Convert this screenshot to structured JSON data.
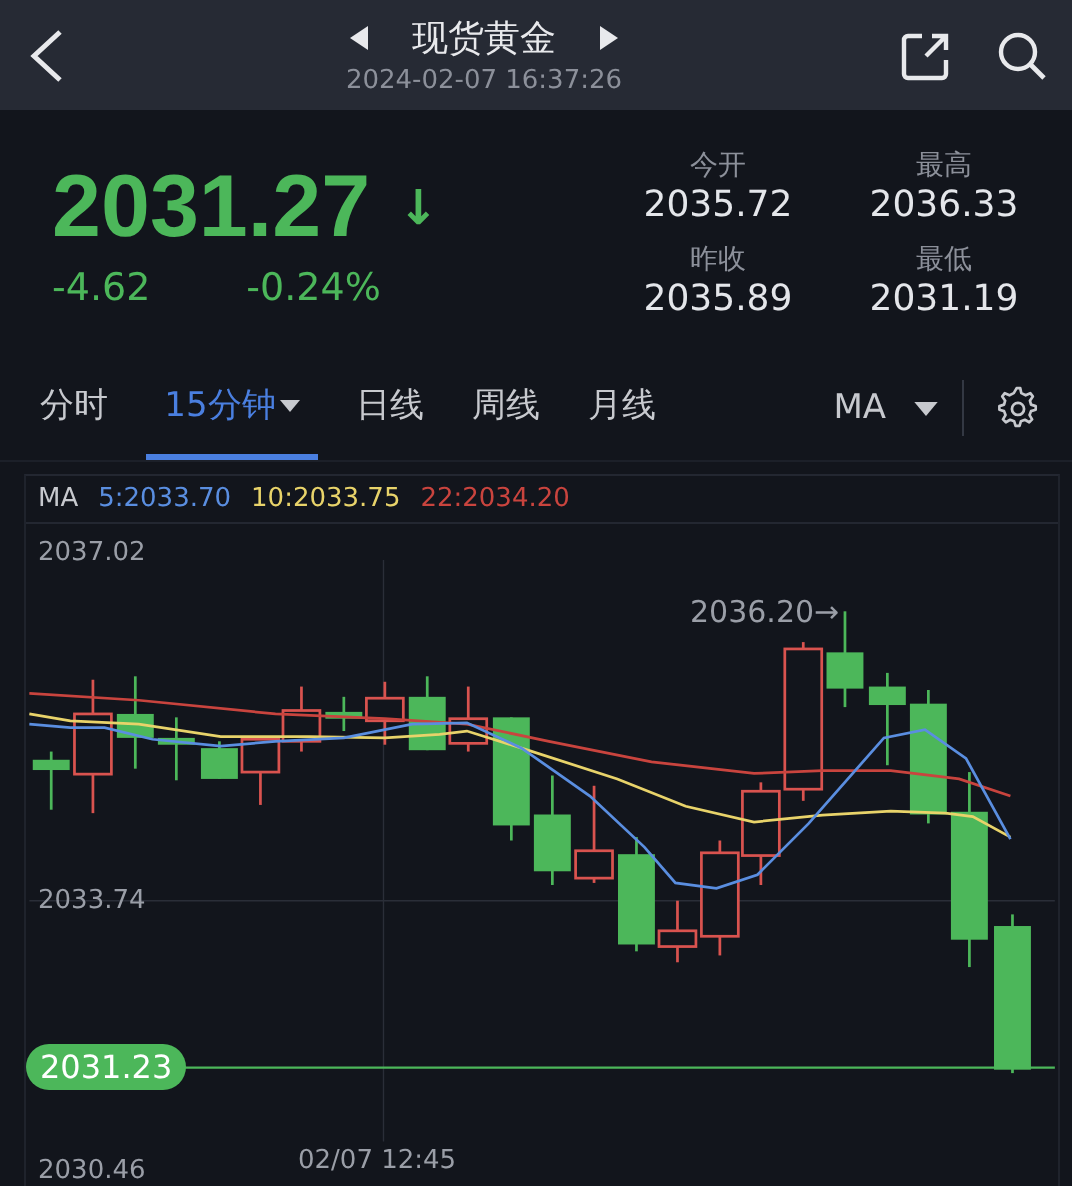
{
  "header": {
    "title": "现货黄金",
    "datetime": "2024-02-07 16:37:26"
  },
  "quote": {
    "price": "2031.27",
    "arrow": "↓",
    "change": "-4.62",
    "change_percent": "-0.24%"
  },
  "stats": [
    {
      "label": "今开",
      "value": "2035.72"
    },
    {
      "label": "最高",
      "value": "2036.33"
    },
    {
      "label": "昨收",
      "value": "2035.89"
    },
    {
      "label": "最低",
      "value": "2031.19"
    }
  ],
  "tabs": [
    {
      "label": "分时",
      "selected": false,
      "dropdown": false
    },
    {
      "label": "15分钟",
      "selected": true,
      "dropdown": true
    },
    {
      "label": "日线",
      "selected": false,
      "dropdown": false
    },
    {
      "label": "周线",
      "selected": false,
      "dropdown": false
    },
    {
      "label": "月线",
      "selected": false,
      "dropdown": false
    }
  ],
  "indicator": {
    "label": "MA"
  },
  "ma_legend": {
    "label": "MA",
    "items": [
      {
        "text": "5:2033.70",
        "color": "#5a8ee0"
      },
      {
        "text": "10:2033.75",
        "color": "#e8d36a"
      },
      {
        "text": "22:2034.20",
        "color": "#c9443e"
      }
    ]
  },
  "chart": {
    "y_labels": [
      "2037.02",
      "2033.74",
      "2030.46"
    ],
    "high_marker": "2036.20→",
    "current_price": "2031.23",
    "time_label": "02/07 12:45"
  }
}
